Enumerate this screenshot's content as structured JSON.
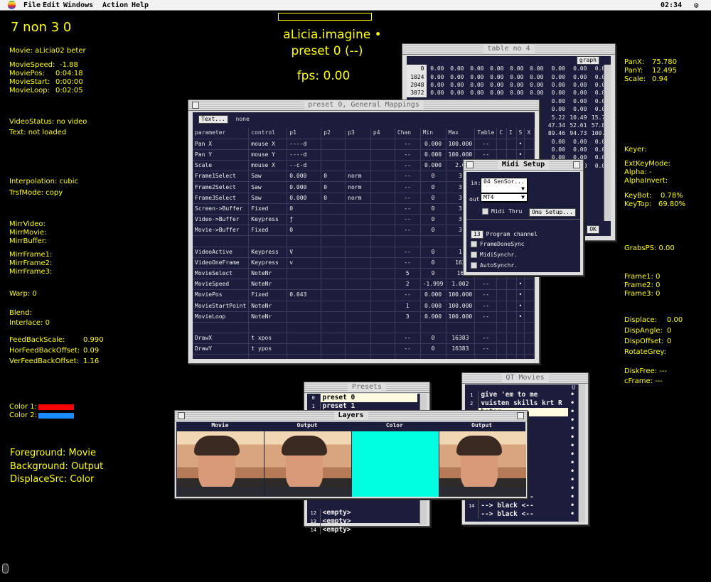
{
  "menubar": {
    "items": [
      "File",
      "Edit",
      "Windows",
      "Action",
      "Help"
    ],
    "clock": "02:34",
    "right_icon": "app-switcher-icon"
  },
  "center": {
    "title": "aLicia.imagine •",
    "preset": "preset 0 (--)",
    "fps": "fps: 0.00"
  },
  "left": {
    "header": "7 non 3 0",
    "movie": "Movie: aLicia02 beter",
    "movie_speed_label": "MovieSpeed:",
    "movie_speed": "-1.88",
    "movie_pos_label": "MoviePos:",
    "movie_pos": "0:04:18",
    "movie_start_label": "MovieStart:",
    "movie_start": "0:00:00",
    "movie_loop_label": "MovieLoop:",
    "movie_loop": "0:02:05",
    "video_status": "VideoStatus: no video",
    "text_status": "Text: not loaded",
    "interpolation": "Interpolation: cubic",
    "trsf_mode": "TrsfMode: copy",
    "mirr_video": "MirrVideo:",
    "mirr_movie": "MirrMovie:",
    "mirr_buffer": "MirrBuffer:",
    "mirr_frame1": "MirrFrame1:",
    "mirr_frame2": "MirrFrame2:",
    "mirr_frame3": "MirrFrame3:",
    "warp": "Warp: 0",
    "blend": "Blend:",
    "interlace": "Interlace:  0",
    "feedback_scale_label": "FeedBackScale:",
    "feedback_scale": "0.990",
    "hor_feedback_label": "HorFeedBackOffset:",
    "hor_feedback": "0.09",
    "ver_feedback_label": "VerFeedBackOffset:",
    "ver_feedback": "1.16",
    "color1": "Color 1:",
    "color2": "Color 2:",
    "color1_hex": "#ff0000",
    "color2_hex": "#1a8cff",
    "foreground": "Foreground: Movie",
    "background": "Background: Output",
    "displace_src": "DisplaceSrc: Color"
  },
  "right": {
    "panx_label": "PanX:",
    "panx": "75.780",
    "pany_label": "PanY:",
    "pany": "12.495",
    "scale_label": "Scale:",
    "scale": "0.94",
    "keyer": "Keyer:",
    "ext_key_mode": "ExtKeyMode:",
    "alpha": "Alpha: -",
    "alpha_invert": "AlphaInvert:",
    "keybot_label": "KeyBot:",
    "keybot": "0.78%",
    "keytop_label": "KeyTop:",
    "keytop": "69.80%",
    "grabs_ps": "GrabsPS: 0.00",
    "frame1": "Frame1: 0",
    "frame2": "Frame2: 0",
    "frame3": "Frame3: 0",
    "displace_label": "Displace:",
    "displace": "0.00",
    "disp_angle_label": "DispAngle:",
    "disp_angle": "0",
    "disp_offset_label": "DispOffset:",
    "disp_offset": "0",
    "rotate_grey": "RotateGrey:",
    "disk_free": "DiskFree: ---",
    "cframe": "cFrame: ---"
  },
  "table_no4": {
    "title": "table no 4",
    "graph_button": "graph",
    "ok_button": "OK",
    "row_labels": [
      "0",
      "1024",
      "2048",
      "3072"
    ],
    "rows": [
      [
        "0.00",
        "0.00",
        "0.00",
        "0.00",
        "0.00",
        "0.00",
        "0.00",
        "0.00",
        "0.00"
      ],
      [
        "0.00",
        "0.00",
        "0.00",
        "0.00",
        "0.00",
        "0.00",
        "0.00",
        "0.00",
        "0.00"
      ],
      [
        "0.00",
        "0.00",
        "0.00",
        "0.00",
        "0.00",
        "0.00",
        "0.00",
        "0.00",
        "0.00"
      ],
      [
        "0.00",
        "0.00",
        "0.00",
        "0.00",
        "0.00",
        "0.00",
        "0.00",
        "0.00",
        "0.00"
      ]
    ],
    "extra_rows": [
      [
        "0.00",
        "0.00",
        "0.00"
      ],
      [
        "0.00",
        "0.00",
        "0.00"
      ],
      [
        "5.22",
        "10.49",
        "15.75"
      ],
      [
        "47.34",
        "52.61",
        "57.88"
      ],
      [
        "89.46",
        "94.73",
        "100.0"
      ],
      [
        "0.00",
        "0.00",
        "0.00"
      ],
      [
        "0.00",
        "0.00",
        "0.00"
      ],
      [
        "0.00",
        "0.00",
        "0.00"
      ],
      [
        "0.00",
        "0.00",
        "0.00"
      ]
    ]
  },
  "mappings": {
    "title": "preset 0, General Mappings",
    "text_button": "Text...",
    "text_value": "none",
    "headers": [
      "parameter",
      "control",
      "p1",
      "p2",
      "p3",
      "p4",
      "Chan",
      "Min",
      "Max",
      "Table",
      "C",
      "I",
      "S",
      "X"
    ],
    "rows": [
      [
        "Pan X",
        "mouse X",
        "----d",
        "",
        "",
        "",
        "--",
        "0.000",
        "100.000",
        "--",
        "",
        "",
        "•",
        ""
      ],
      [
        "Pan Y",
        "mouse Y",
        "----d",
        "",
        "",
        "",
        "--",
        "0.000",
        "100.000",
        "--",
        "",
        "",
        "•",
        ""
      ],
      [
        "Scale",
        "mouse X",
        "--c-d",
        "",
        "",
        "",
        "--",
        "0.000",
        "2.0",
        "",
        "",
        "",
        "",
        ""
      ],
      [
        "Frame1Select",
        "Saw",
        "0.000",
        "0",
        "norm",
        "",
        "--",
        "0",
        "3",
        "",
        "",
        "",
        "",
        ""
      ],
      [
        "Frame2Select",
        "Saw",
        "0.000",
        "0",
        "norm",
        "",
        "--",
        "0",
        "3",
        "",
        "",
        "",
        "",
        ""
      ],
      [
        "Frame3Select",
        "Saw",
        "0.000",
        "0",
        "norm",
        "",
        "--",
        "0",
        "3",
        "",
        "",
        "",
        "",
        ""
      ],
      [
        "Screen->Buffer",
        "Fixed",
        "0",
        "",
        "",
        "",
        "--",
        "0",
        "3",
        "",
        "",
        "",
        "",
        ""
      ],
      [
        "Video->Buffer",
        "Keypress",
        "ƒ",
        "",
        "",
        "",
        "--",
        "0",
        "3",
        "",
        "",
        "",
        "",
        ""
      ],
      [
        "Movie->Buffer",
        "Fixed",
        "0",
        "",
        "",
        "",
        "--",
        "0",
        "3",
        "",
        "",
        "",
        "",
        ""
      ],
      [
        "",
        "",
        "",
        "",
        "",
        "",
        "",
        "",
        "",
        "",
        "",
        "",
        "",
        ""
      ],
      [
        "VideoActive",
        "Keypress",
        "V",
        "",
        "",
        "",
        "--",
        "0",
        "1",
        "",
        "",
        "",
        "",
        ""
      ],
      [
        "VideoOneFrame",
        "Keypress",
        "v",
        "",
        "",
        "",
        "--",
        "0",
        "163",
        "",
        "",
        "",
        "",
        ""
      ],
      [
        "MovieSelect",
        "NoteNr",
        "",
        "",
        "",
        "",
        "5",
        "9",
        "16",
        "",
        "",
        "",
        "",
        ""
      ],
      [
        "MovieSpeed",
        "NoteNr",
        "",
        "",
        "",
        "",
        "2",
        "-1.999",
        "1.002",
        "--",
        "",
        "",
        "•",
        ""
      ],
      [
        "MoviePos",
        "Fixed",
        "0.043",
        "",
        "",
        "",
        "--",
        "0.000",
        "100.000",
        "--",
        "",
        "",
        "•",
        ""
      ],
      [
        "MovieStartPoint",
        "NoteNr",
        "",
        "",
        "",
        "",
        "1",
        "0.000",
        "100.000",
        "--",
        "",
        "",
        "•",
        ""
      ],
      [
        "MovieLoop",
        "NoteNr",
        "",
        "",
        "",
        "",
        "3",
        "0.000",
        "100.000",
        "--",
        "",
        "",
        "•",
        ""
      ],
      [
        "",
        "",
        "",
        "",
        "",
        "",
        "",
        "",
        "",
        "",
        "",
        "",
        "",
        ""
      ],
      [
        "DrawX",
        "t xpos",
        "",
        "",
        "",
        "",
        "--",
        "0",
        "16383",
        "--",
        "",
        "",
        "",
        ""
      ],
      [
        "DrawY",
        "t ypos",
        "",
        "",
        "",
        "",
        "--",
        "0",
        "16383",
        "--",
        "",
        "",
        "",
        ""
      ],
      [
        "",
        "",
        "",
        "",
        "",
        "",
        "",
        "",
        "",
        "",
        "",
        "",
        "",
        ""
      ]
    ]
  },
  "midi": {
    "title": "Midi Setup",
    "in_label": "in:",
    "in_value": "04 SenSor...",
    "out_label": "out:",
    "out_value": "MT4",
    "midi_thru": "Midi Thru",
    "oms_button": "Oms Setup...",
    "program_channel_value": "13",
    "program_channel": "Program channel",
    "frame_done_sync": "FrameDoneSync",
    "midi_synchr": "MidiSynchr.",
    "auto_synchr": "AutoSynchr."
  },
  "presets": {
    "title": "Presets",
    "top": [
      [
        "0",
        "preset 0"
      ],
      [
        "1",
        "preset 1"
      ]
    ],
    "bottom": [
      [
        "12",
        "<empty>"
      ],
      [
        "13",
        "<empty>"
      ],
      [
        "14",
        "<empty>"
      ]
    ]
  },
  "qt": {
    "title": "QT Movies",
    "col_u": "U",
    "rows": [
      [
        "1",
        "give 'em to me"
      ],
      [
        "2",
        "vuisten skills krt R"
      ],
      [
        "",
        "beter"
      ],
      [
        "",
        "--    384..."
      ],
      [
        "",
        "beter.CP"
      ],
      [
        "",
        "CP"
      ],
      [
        "",
        "kaaL krtr"
      ],
      [
        "",
        "kaaL krtr"
      ],
      [
        "",
        "--"
      ],
      [
        "",
        "--"
      ],
      [
        "",
        "--"
      ],
      [
        "",
        "--"
      ],
      [
        "",
        "--> black <--"
      ],
      [
        "14",
        "--> black <--"
      ],
      [
        "",
        "--> black <--"
      ]
    ]
  },
  "layers": {
    "title": "Layers",
    "headers": [
      "Movie",
      "Output",
      "Color",
      "Output"
    ],
    "color_hex": "#00ffe0"
  }
}
